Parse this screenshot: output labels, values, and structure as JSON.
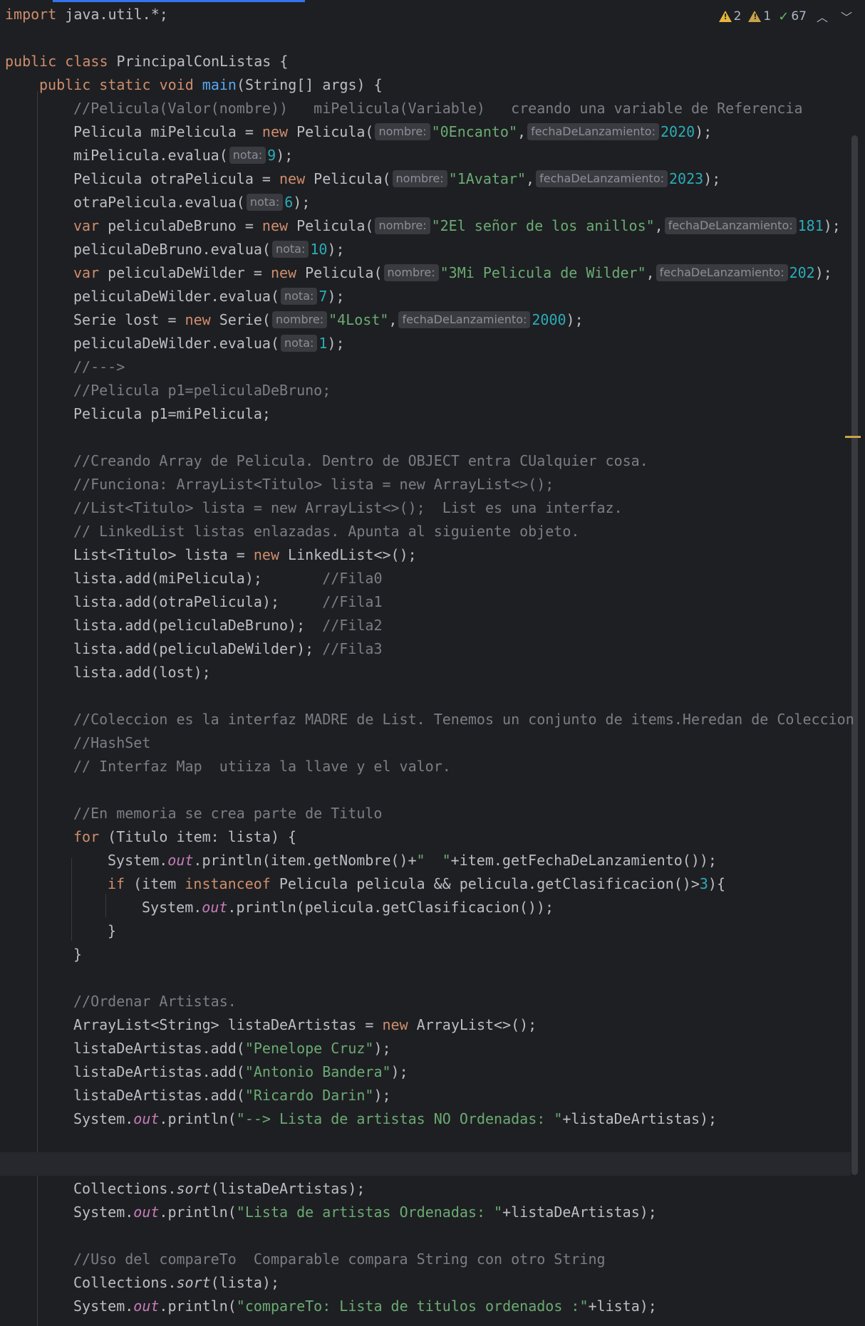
{
  "inspections": {
    "warnings": "2",
    "weak_warnings": "1",
    "typos": "67"
  },
  "code": {
    "l1": "import java.util.*;",
    "l3": {
      "kw": "public class ",
      "name": "PrincipalConListas",
      "brace": " {"
    },
    "l4": {
      "kw": "public static void ",
      "fn": "main",
      "rest": "(String[] args) {"
    },
    "l5": "//Pelicula(Valor(nombre))   miPelicula(Variable)   creando una variable de Referencia",
    "l6": {
      "a": "Pelicula miPelicula = ",
      "new": "new",
      "b": " Pelicula(",
      "h1": "nombre:",
      "s": "\"0Encanto\"",
      "c": ",",
      "h2": "fechaDeLanzamiento:",
      "n": "2020",
      "d": ");"
    },
    "l7": {
      "a": "miPelicula.evalua(",
      "h": "nota:",
      "n": "9",
      "b": ");"
    },
    "l8": {
      "a": "Pelicula otraPelicula = ",
      "new": "new",
      "b": " Pelicula(",
      "h1": "nombre:",
      "s": "\"1Avatar\"",
      "c": ",",
      "h2": "fechaDeLanzamiento:",
      "n": "2023",
      "d": ");"
    },
    "l9": {
      "a": "otraPelicula.evalua(",
      "h": "nota:",
      "n": "6",
      "b": ");"
    },
    "l10": {
      "var": "var",
      "a": " peliculaDeBruno = ",
      "new": "new",
      "b": " Pelicula(",
      "h1": "nombre:",
      "s": "\"2El señor de los anillos\"",
      "c": ",",
      "h2": "fechaDeLanzamiento:",
      "n": "181",
      "d": ");"
    },
    "l11": {
      "a": "peliculaDeBruno.evalua(",
      "h": "nota:",
      "n": "10",
      "b": ");"
    },
    "l12": {
      "var": "var",
      "a": " peliculaDeWilder = ",
      "new": "new",
      "b": " Pelicula(",
      "h1": "nombre:",
      "s": "\"3Mi Pelicula de Wilder\"",
      "c": ",",
      "h2": "fechaDeLanzamiento:",
      "n": "202",
      "d": ");"
    },
    "l13": {
      "a": "peliculaDeWilder.evalua(",
      "h": "nota:",
      "n": "7",
      "b": ");"
    },
    "l14": {
      "a": "Serie lost = ",
      "new": "new",
      "b": " Serie(",
      "h1": "nombre:",
      "s": "\"4Lost\"",
      "c": ",",
      "h2": "fechaDeLanzamiento:",
      "n": "2000",
      "d": ");"
    },
    "l15": {
      "a": "peliculaDeWilder.evalua(",
      "h": "nota:",
      "n": "1",
      "b": ");"
    },
    "l16": "//--->",
    "l17": "//Pelicula p1=peliculaDeBruno;",
    "l18": "Pelicula p1=miPelicula;",
    "l20": "//Creando Array de Pelicula. Dentro de OBJECT entra CUalquier cosa.",
    "l21": "//Funciona: ArrayList<Titulo> lista = new ArrayList<>();",
    "l22": "//List<Titulo> lista = new ArrayList<>();  List es una interfaz.",
    "l23": "// LinkedList listas enlazadas. Apunta al siguiente objeto.",
    "l24": {
      "a": "List<Titulo> lista = ",
      "new": "new",
      "b": " LinkedList<>();"
    },
    "l25": {
      "a": "lista.add(miPelicula);       ",
      "c": "//Fila0"
    },
    "l26": {
      "a": "lista.add(otraPelicula);     ",
      "c": "//Fila1"
    },
    "l27": {
      "a": "lista.add(peliculaDeBruno);  ",
      "c": "//Fila2"
    },
    "l28": {
      "a": "lista.add(peliculaDeWilder); ",
      "c": "//Fila3"
    },
    "l29": "lista.add(lost);",
    "l31": "//Coleccion es la interfaz MADRE de List. Tenemos un conjunto de items.Heredan de Coleccion",
    "l32": "//HashSet",
    "l33": "// Interfaz Map  utiiza la llave y el valor.",
    "l35": "//En memoria se crea parte de Titulo",
    "l36": {
      "kw": "for",
      "a": " (Titulo item: lista) {"
    },
    "l37": {
      "a": "System.",
      "f": "out",
      "b": ".println(item.getNombre()+",
      "s": "\"  \"",
      "c": "+item.getFechaDeLanzamiento());"
    },
    "l38": {
      "kw": "if",
      "a": " (item ",
      "kw2": "instanceof",
      "b": " Pelicula pelicula && pelicula.getClasificacion()>",
      "n": "3",
      "c": "){"
    },
    "l39": {
      "a": "System.",
      "f": "out",
      "b": ".println(pelicula.getClasificacion());"
    },
    "l40": "}",
    "l41": "}",
    "l43": "//Ordenar Artistas.",
    "l44": {
      "a": "ArrayList<String> listaDeArtistas = ",
      "new": "new",
      "b": " ArrayList<>();"
    },
    "l45": {
      "a": "listaDeArtistas.add(",
      "s": "\"Penelope Cruz\"",
      "b": ");"
    },
    "l46": {
      "a": "listaDeArtistas.add(",
      "s": "\"Antonio Bandera\"",
      "b": ");"
    },
    "l47": {
      "a": "listaDeArtistas.add(",
      "s": "\"Ricardo Darin\"",
      "b": ");"
    },
    "l48": {
      "a": "System.",
      "f": "out",
      "b": ".println(",
      "s": "\"--> Lista de artistas NO Ordenadas: \"",
      "c": "+listaDeArtistas);"
    },
    "l51": {
      "a": "Collections.",
      "m": "sort",
      "b": "(listaDeArtistas);"
    },
    "l52": {
      "a": "System.",
      "f": "out",
      "b": ".println(",
      "s": "\"Lista de artistas Ordenadas: \"",
      "c": "+listaDeArtistas);"
    },
    "l54": "//Uso del compareTo  Comparable compara String con otro String",
    "l55": {
      "a": "Collections.",
      "m": "sort",
      "b": "(lista);"
    },
    "l56": {
      "a": "System.",
      "f": "out",
      "b": ".println(",
      "s": "\"compareTo: Lista de titulos ordenados :\"",
      "c": "+lista);"
    }
  }
}
